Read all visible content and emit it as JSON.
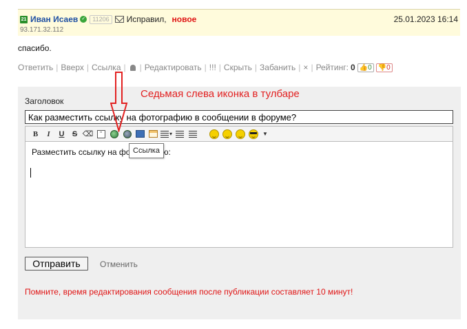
{
  "post": {
    "level": "21",
    "username": "Иван Исаев",
    "message_count": "11206",
    "subject": "Исправил,",
    "new_label": "новое",
    "date": "25.01.2023 16:14",
    "ip": "93.171.32.112",
    "body": "спасибо."
  },
  "actions": {
    "reply": "Ответить",
    "up": "Вверх",
    "link": "Ссылка",
    "edit": "Редактировать",
    "exclaim": "!!!",
    "hide": "Скрыть",
    "ban": "Забанить",
    "close": "×",
    "rating_label": "Рейтинг:",
    "rating_value": "0",
    "likes": "0",
    "dislikes": "0"
  },
  "editor": {
    "title_label": "Заголовок",
    "title_value": "Как разместить ссылку на фотографию в сообщении в форуме?",
    "body_text": "Разместить ссылку на фотографию:",
    "tooltip": "Ссылка",
    "submit_label": "Отправить",
    "cancel_label": "Отменить",
    "warning": "Помните, время редактирования сообщения после публикации составляет 10 минут!",
    "toolbar_icons": [
      "bold-icon",
      "italic-icon",
      "underline-icon",
      "strikethrough-icon",
      "eraser-icon",
      "quote-icon",
      "link-icon",
      "unlink-icon",
      "image-icon",
      "table-icon",
      "align-icon",
      "ordered-list-icon",
      "unordered-list-icon"
    ]
  },
  "annotation": {
    "caption": "Седьмая слева иконка в тулбаре",
    "color": "#e22020"
  },
  "colors": {
    "header_bg": "#fffbdc",
    "username": "#1e4fa3",
    "alert": "#e01414",
    "panel_bg": "#efefef"
  }
}
